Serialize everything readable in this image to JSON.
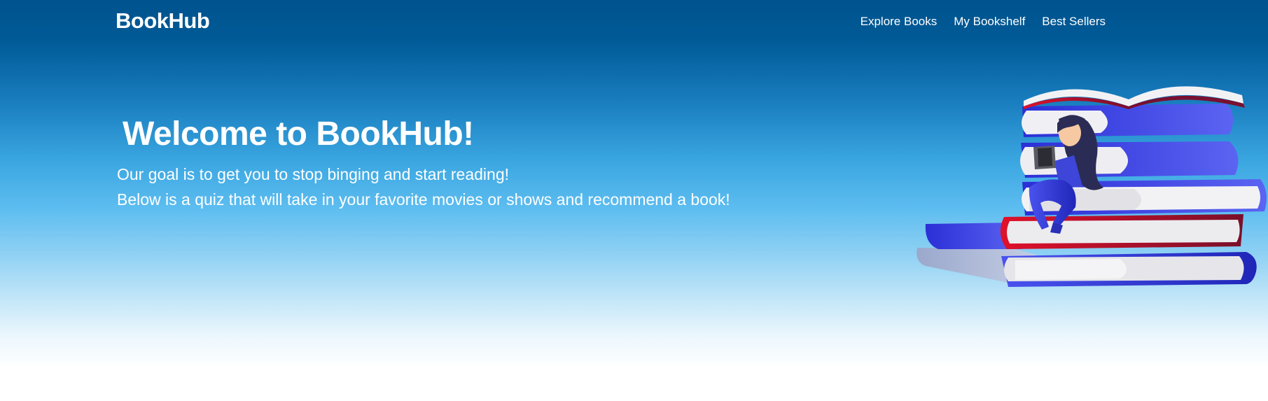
{
  "navbar": {
    "brand": "BookHub",
    "links": [
      "Explore Books",
      "My Bookshelf",
      "Best Sellers"
    ]
  },
  "hero": {
    "title": "Welcome to BookHub!",
    "line1": "Our goal is to get you to stop binging and start reading!",
    "line2": "Below is a quiz that will take in your favorite movies or shows and recommend a book!"
  },
  "illustration": {
    "icon": "girl-reading-on-book-stack-illustration"
  },
  "colors": {
    "header_blue": "#00538e",
    "sky_blue": "#5dbdf0",
    "book_blue": "#3a3fd8",
    "book_red": "#c8102e"
  }
}
